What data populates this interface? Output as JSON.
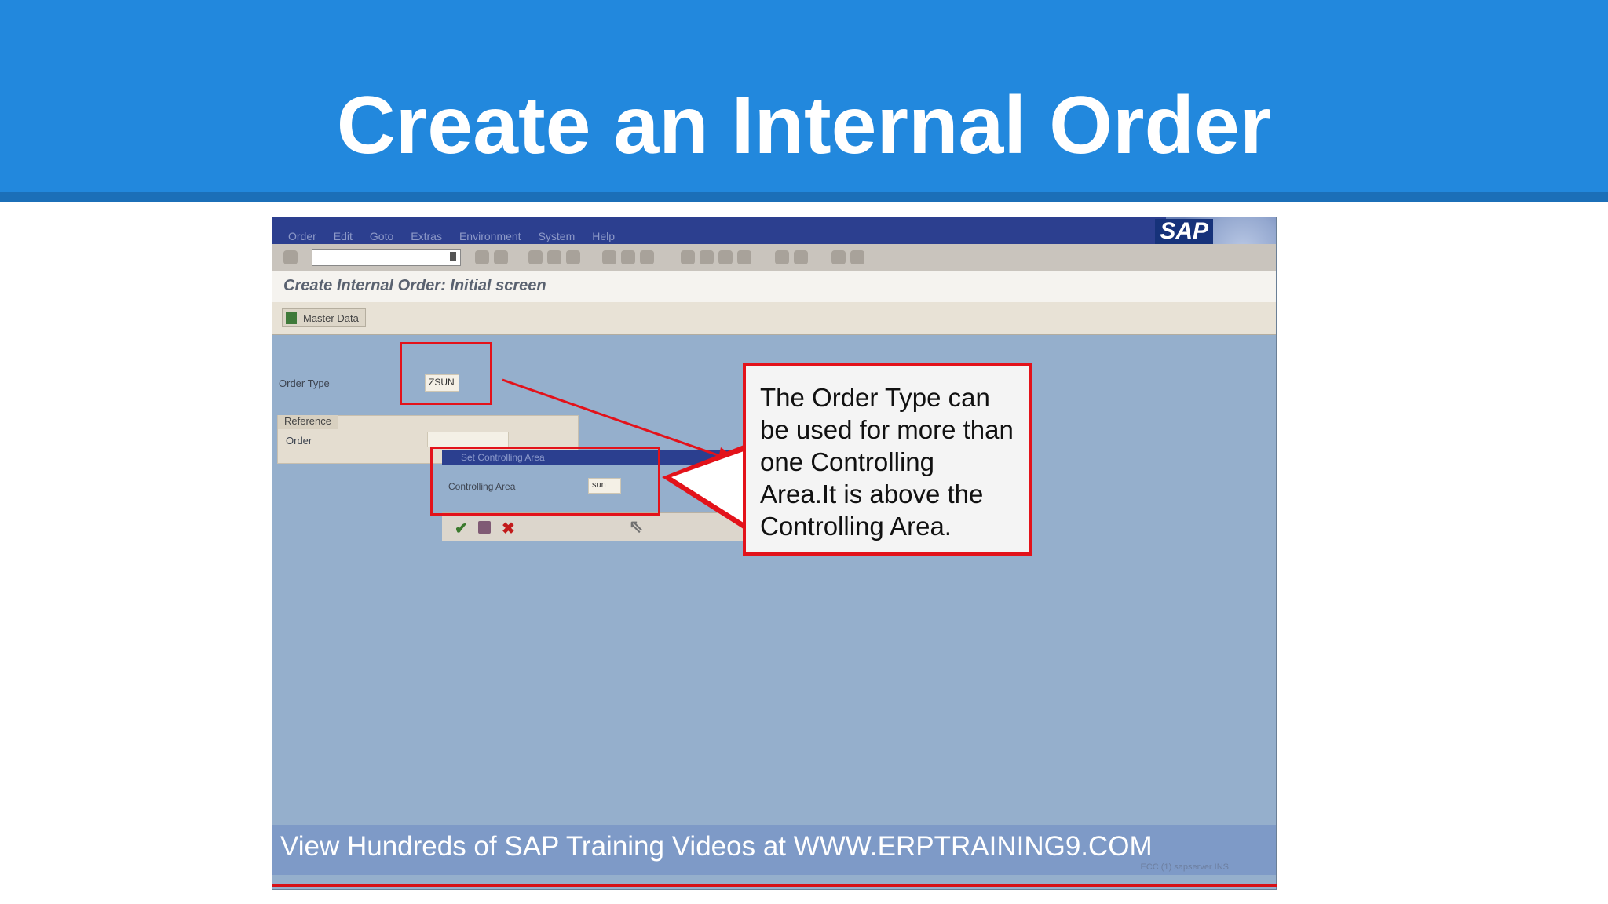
{
  "slide": {
    "title": "Create an Internal Order",
    "header_color": "#2288dd"
  },
  "sap": {
    "menu": [
      "Order",
      "Edit",
      "Goto",
      "Extras",
      "Environment",
      "System",
      "Help"
    ],
    "logo": "SAP",
    "screen_title": "Create Internal Order: Initial screen",
    "master_data_button": "Master Data",
    "order_type_label": "Order Type",
    "order_type_value": "ZSUN",
    "reference_tab": "Reference",
    "reference_order_label": "Order",
    "popup": {
      "title": "Set Controlling Area",
      "field_label": "Controlling Area",
      "field_value": "sun",
      "confirm_icon": "check-icon",
      "save_icon": "save-icon",
      "cancel_icon": "cancel-icon"
    },
    "status_hint": "ECC (1) sapserver INS"
  },
  "callout": {
    "text": "The Order Type can be used for more than one Controlling Area.It is above the Controlling Area."
  },
  "watermark": "View Hundreds of SAP Training Videos at WWW.ERPTRAINING9.COM",
  "colors": {
    "highlight_red": "#e3121a",
    "sap_background": "#95afcc"
  }
}
